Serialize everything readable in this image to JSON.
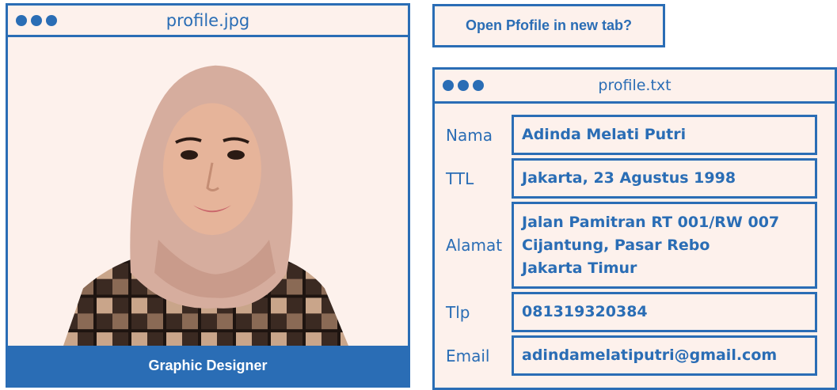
{
  "colors": {
    "accent": "#2a6db5",
    "background": "#fdf1ec"
  },
  "photo_window": {
    "title": "profile.jpg",
    "caption": "Graphic Designer"
  },
  "prompt": {
    "label": "Open Pfofile in new tab?"
  },
  "text_window": {
    "title": "profile.txt",
    "fields": [
      {
        "label": "Nama",
        "value": [
          "Adinda Melati Putri"
        ]
      },
      {
        "label": "TTL",
        "value": [
          "Jakarta, 23 Agustus 1998"
        ]
      },
      {
        "label": "Alamat",
        "value": [
          "Jalan Pamitran RT 001/RW 007",
          "Cijantung, Pasar Rebo",
          "Jakarta Timur"
        ]
      },
      {
        "label": "Tlp",
        "value": [
          "081319320384"
        ]
      },
      {
        "label": "Email",
        "value": [
          "adindamelatiputri@gmail.com"
        ]
      }
    ]
  }
}
